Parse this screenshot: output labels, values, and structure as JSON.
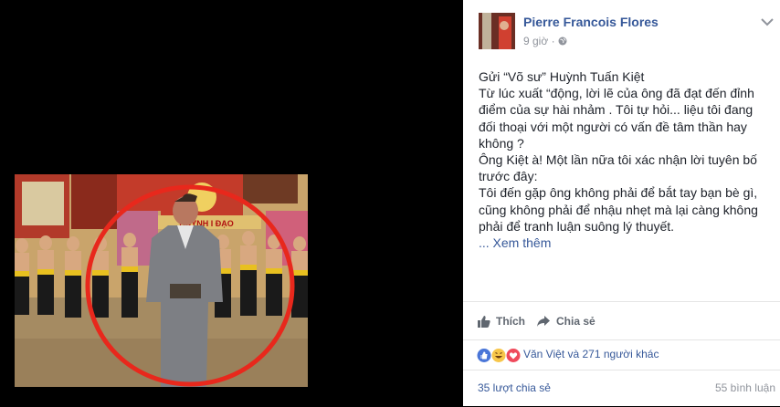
{
  "post": {
    "author": "Pierre Francois Flores",
    "time": "9 giờ",
    "privacy_icon": "globe-icon",
    "lines": [
      "Gửi “Võ sư” Huỳnh Tuấn Kiệt",
      "Từ lúc xuất “động, lời lẽ của ông đã đạt đến đỉnh",
      "điểm của sự hài nhảm . Tôi tự hỏi... liệu tôi đang",
      "đối thoại với một người có vấn đề tâm thần hay",
      "không ?",
      "Ông Kiệt à! Một lần nữa tôi xác nhận lời tuyên bố",
      "trước đây:",
      "Tôi đến gặp ông không phải để bắt tay bạn bè gì,",
      "cũng không phải để nhậu nhẹt mà lại càng không",
      "phải để tranh luận suông lý thuyết."
    ],
    "see_more": "... Xem thêm"
  },
  "actions": {
    "like": "Thích",
    "share": "Chia sẻ"
  },
  "reactions": {
    "icons": [
      "like-icon",
      "haha-icon",
      "love-icon"
    ],
    "text": "Văn Việt và 271 người khác"
  },
  "stats": {
    "shares": "35 lượt chia sẻ",
    "comments": "55 bình luận"
  },
  "photo": {
    "sign_text": "HUỲNH I ĐẠO",
    "circle_color": "#e8281c"
  },
  "colors": {
    "link": "#365899",
    "muted": "#90949c",
    "text": "#1d2129"
  }
}
